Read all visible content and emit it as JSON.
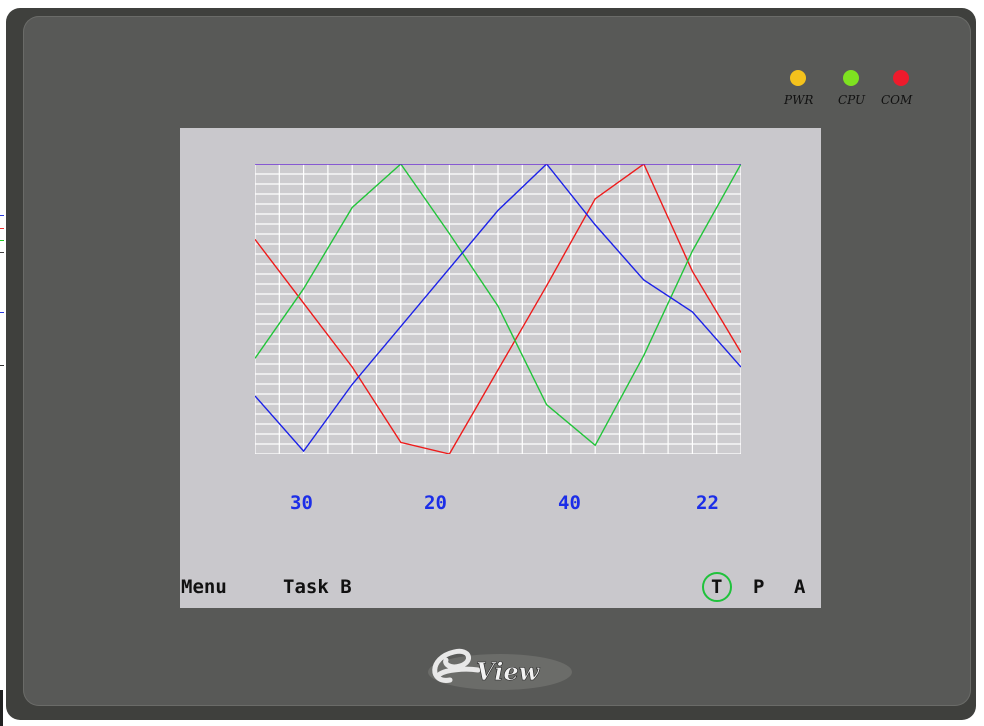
{
  "indicators": [
    {
      "label": "PWR",
      "color": "#f4c21c"
    },
    {
      "label": "CPU",
      "color": "#7ee220"
    },
    {
      "label": "COM",
      "color": "#ee1b2c"
    }
  ],
  "chart_data": {
    "type": "line",
    "title": "",
    "xlabel": "",
    "ylabel": "",
    "grid": true,
    "ylim": [
      0,
      100
    ],
    "x": [
      0,
      2.5,
      5,
      7.5,
      10,
      12.5,
      15,
      17.5,
      20,
      22.5,
      25
    ],
    "series": [
      {
        "color": "#ee1b1b",
        "values": [
          74,
          52,
          30,
          4,
          0,
          29,
          58,
          88,
          100,
          63,
          35
        ]
      },
      {
        "color": "#22c43a",
        "values": [
          33,
          57,
          85,
          100,
          76,
          51,
          17,
          3,
          34,
          70,
          100
        ]
      },
      {
        "color": "#1c22e8",
        "values": [
          20,
          1,
          24,
          44,
          64,
          84,
          100,
          79,
          60,
          49,
          30
        ]
      },
      {
        "color": "#6a2fd0",
        "values": [
          100,
          100,
          100,
          100,
          100,
          100,
          100,
          100,
          100,
          100,
          100
        ]
      }
    ]
  },
  "values": [
    "30",
    "20",
    "40",
    "22"
  ],
  "footer": {
    "menu": "Menu",
    "task": "Task B",
    "t": "T",
    "p": "P",
    "a": "A"
  },
  "brand": "View",
  "colors": {
    "bezel": "#3f403d",
    "panel": "#585957",
    "screen": "#c9c8cc",
    "value_text": "#1c2ee8",
    "t_ring": "#1fc23b"
  }
}
